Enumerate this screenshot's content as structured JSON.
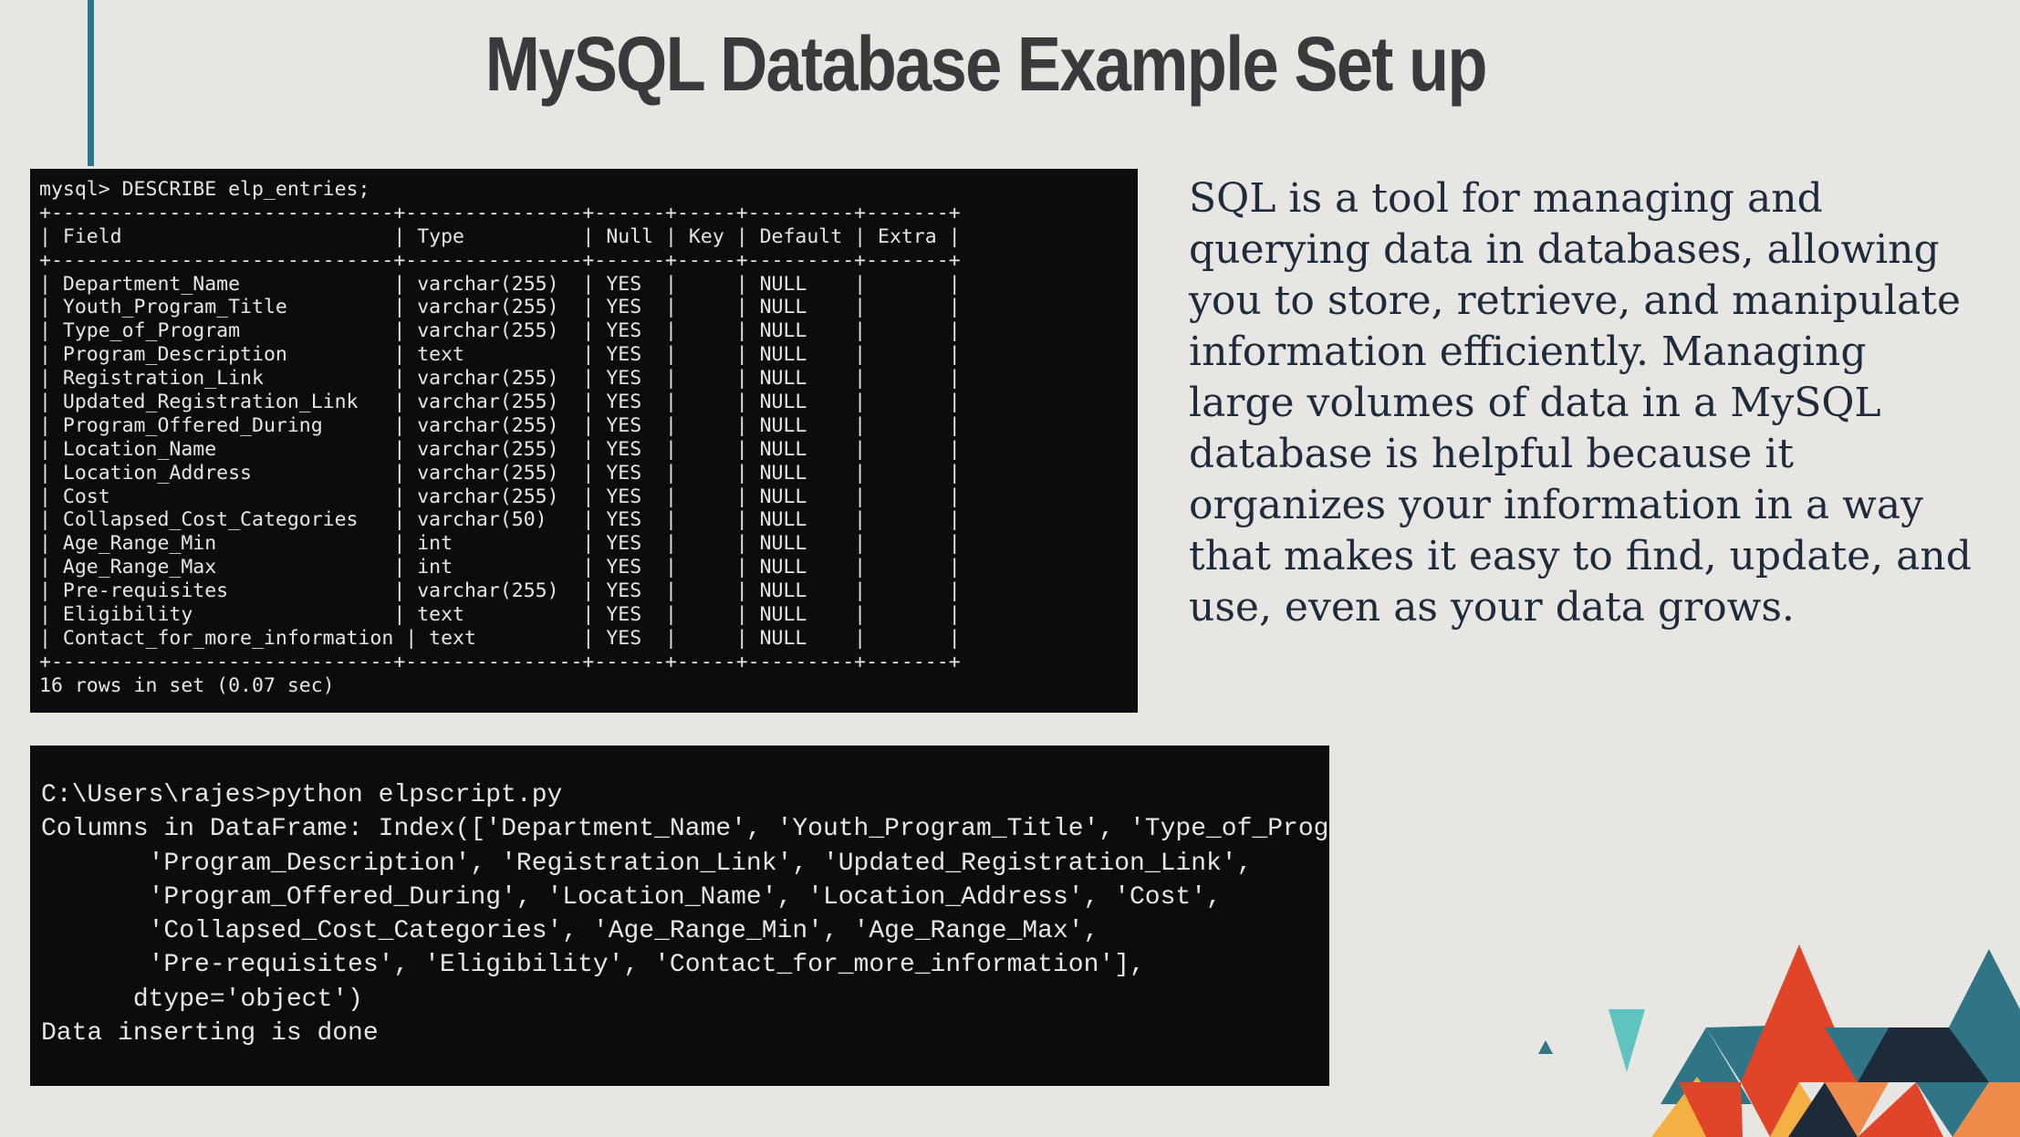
{
  "slide": {
    "title": "MySQL Database Example Set up",
    "description": "SQL is a tool for managing and querying data in databases, allowing you to store, retrieve, and manipulate information efficiently. Managing large volumes of data in a MySQL database is helpful because it organizes your information in a way that makes it easy to find, update, and use, even as your data grows."
  },
  "terminal1": {
    "lines": [
      "mysql> DESCRIBE elp_entries;",
      "+-----------------------------+---------------+------+-----+---------+-------+",
      "| Field                       | Type          | Null | Key | Default | Extra |",
      "+-----------------------------+---------------+------+-----+---------+-------+",
      "| Department_Name             | varchar(255)  | YES  |     | NULL    |       |",
      "| Youth_Program_Title         | varchar(255)  | YES  |     | NULL    |       |",
      "| Type_of_Program             | varchar(255)  | YES  |     | NULL    |       |",
      "| Program_Description         | text          | YES  |     | NULL    |       |",
      "| Registration_Link           | varchar(255)  | YES  |     | NULL    |       |",
      "| Updated_Registration_Link   | varchar(255)  | YES  |     | NULL    |       |",
      "| Program_Offered_During      | varchar(255)  | YES  |     | NULL    |       |",
      "| Location_Name               | varchar(255)  | YES  |     | NULL    |       |",
      "| Location_Address            | varchar(255)  | YES  |     | NULL    |       |",
      "| Cost                        | varchar(255)  | YES  |     | NULL    |       |",
      "| Collapsed_Cost_Categories   | varchar(50)   | YES  |     | NULL    |       |",
      "| Age_Range_Min               | int           | YES  |     | NULL    |       |",
      "| Age_Range_Max               | int           | YES  |     | NULL    |       |",
      "| Pre-requisites              | varchar(255)  | YES  |     | NULL    |       |",
      "| Eligibility                 | text          | YES  |     | NULL    |       |",
      "| Contact_for_more_information | text         | YES  |     | NULL    |       |",
      "+-----------------------------+---------------+------+-----+---------+-------+",
      "16 rows in set (0.07 sec)"
    ]
  },
  "terminal2": {
    "lines": [
      "C:\\Users\\rajes>python elpscript.py",
      "Columns in DataFrame: Index(['Department_Name', 'Youth_Program_Title', 'Type_of_Program',",
      "       'Program_Description', 'Registration_Link', 'Updated_Registration_Link',",
      "       'Program_Offered_During', 'Location_Name', 'Location_Address', 'Cost',",
      "       'Collapsed_Cost_Categories', 'Age_Range_Min', 'Age_Range_Max',",
      "       'Pre-requisites', 'Eligibility', 'Contact_for_more_information'],",
      "      dtype='object')",
      "Data inserting is done"
    ]
  },
  "colors": {
    "background": "#e7e6e2",
    "accent_teal": "#2f7585",
    "decor_light_teal": "#5fc3bf",
    "decor_red": "#e0452a",
    "decor_navy": "#1d2a38",
    "decor_orange": "#f08a4b",
    "decor_yellow": "#f4b042",
    "terminal_bg": "#0c0c0c"
  }
}
